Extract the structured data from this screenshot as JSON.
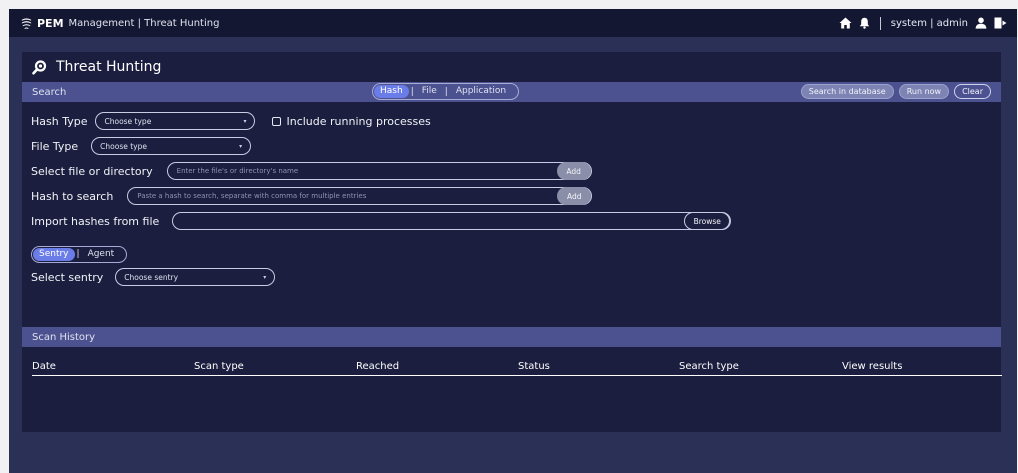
{
  "header": {
    "brand": "PEM",
    "section": "Management | Threat Hunting",
    "user": "system | admin",
    "icons": [
      "home-icon",
      "bell-icon",
      "user-icon",
      "logout-icon"
    ]
  },
  "page": {
    "title": "Threat Hunting"
  },
  "search": {
    "label": "Search",
    "tabs": [
      {
        "label": "Hash",
        "active": true
      },
      {
        "label": "File",
        "active": false
      },
      {
        "label": "Application",
        "active": false
      }
    ],
    "buttons": {
      "search_db": "Search in database",
      "run_now": "Run now",
      "clear": "Clear"
    },
    "hash_type": {
      "label": "Hash Type",
      "value": "Choose type"
    },
    "include_running": {
      "label": "Include running processes",
      "checked": false
    },
    "file_type": {
      "label": "File Type",
      "value": "Choose type"
    },
    "select_file": {
      "label": "Select file or directory",
      "placeholder": "Enter the file's or directory's name",
      "button": "Add"
    },
    "hash_search": {
      "label": "Hash to search",
      "placeholder": "Paste a hash to search, separate with comma for multiple entries",
      "button": "Add"
    },
    "import": {
      "label": "Import hashes from file",
      "button": "Browse"
    },
    "target_tabs": [
      {
        "label": "Sentry",
        "active": true
      },
      {
        "label": "Agent",
        "active": false
      }
    ],
    "select_sentry": {
      "label": "Select sentry",
      "value": "Choose sentry"
    }
  },
  "history": {
    "label": "Scan History",
    "columns": [
      "Date",
      "Scan type",
      "Reached",
      "Status",
      "Search type",
      "View results"
    ],
    "rows": []
  },
  "colors": {
    "accent": "#6a7ce8",
    "panel": "#1b1e3e",
    "section_bar": "#4c5290",
    "topbar": "#141732"
  }
}
